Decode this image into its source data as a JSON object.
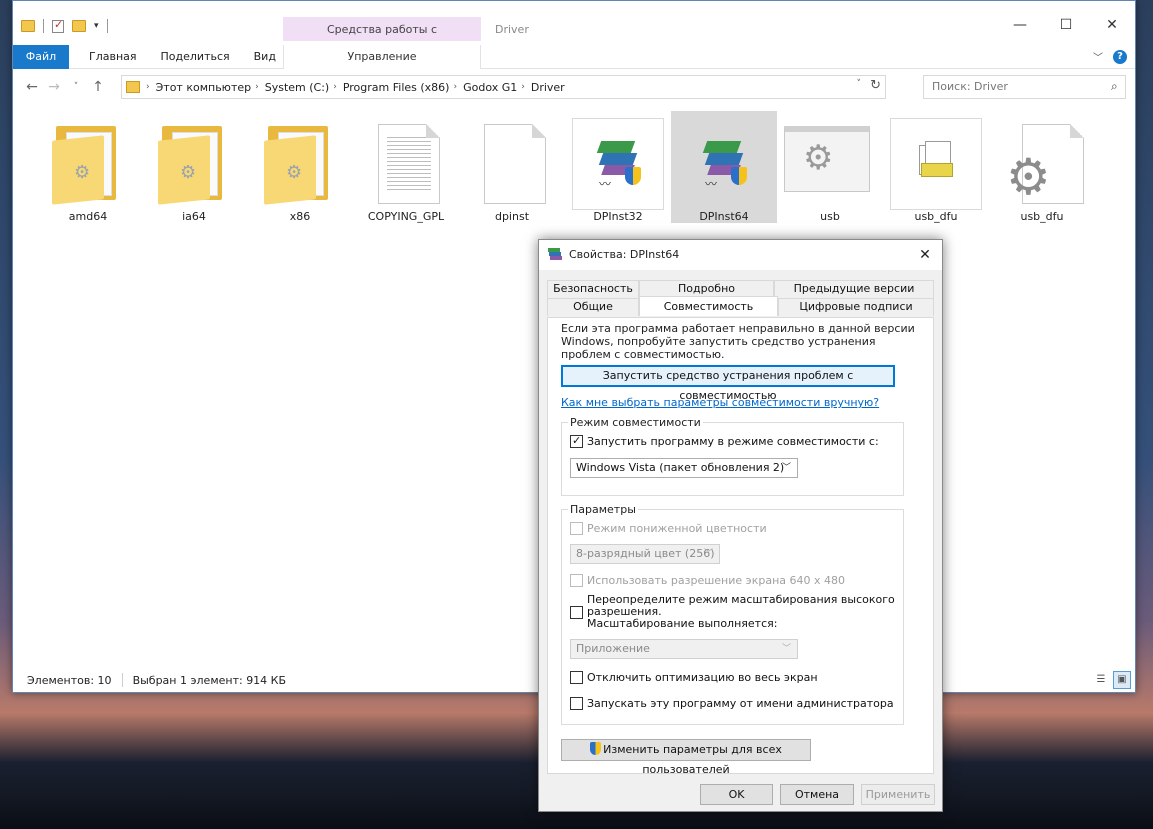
{
  "explorer": {
    "window_title": "Driver",
    "contextual_tab_title": "Средства работы с приложениями",
    "ribbon_tabs": [
      "Файл",
      "Главная",
      "Поделиться",
      "Вид"
    ],
    "contextual_tab": "Управление",
    "breadcrumb": [
      "Этот компьютер",
      "System (C:)",
      "Program Files (x86)",
      "Godox G1",
      "Driver"
    ],
    "search_placeholder": "Поиск: Driver",
    "files": [
      {
        "name": "amd64",
        "icon": "folder-icon"
      },
      {
        "name": "ia64",
        "icon": "folder-icon"
      },
      {
        "name": "x86",
        "icon": "folder-icon"
      },
      {
        "name": "COPYING_GPL",
        "icon": "text-document-icon"
      },
      {
        "name": "dpinst",
        "icon": "blank-document-icon"
      },
      {
        "name": "DPInst32",
        "icon": "installer-icon"
      },
      {
        "name": "DPInst64",
        "icon": "installer-icon",
        "selected": true
      },
      {
        "name": "usb",
        "icon": "settings-window-icon"
      },
      {
        "name": "usb_dfu",
        "icon": "setup-information-icon"
      },
      {
        "name": "usb_dfu",
        "icon": "gear-document-icon"
      }
    ],
    "status": {
      "items_count": "Элементов: 10",
      "selection": "Выбран 1 элемент: 914 КБ"
    }
  },
  "dialog": {
    "title": "Свойства: DPInst64",
    "tabs_row1": [
      "Безопасность",
      "Подробно",
      "Предыдущие версии"
    ],
    "tabs_row2": [
      "Общие",
      "Совместимость",
      "Цифровые подписи"
    ],
    "active_tab": "Совместимость",
    "description": "Если эта программа работает неправильно в данной версии Windows, попробуйте запустить средство устранения проблем с совместимостью.",
    "troubleshooter_button": "Запустить средство устранения проблем с совместимостью",
    "help_link": "Как мне выбрать параметры совместимости вручную?",
    "compat_mode": {
      "group_label": "Режим совместимости",
      "checkbox_label": "Запустить программу в режиме совместимости с:",
      "checked": true,
      "selected_os": "Windows Vista (пакет обновления 2)"
    },
    "params": {
      "group_label": "Параметры",
      "reduced_color_label": "Режим пониженной цветности",
      "color_select": "8-разрядный цвет (256)",
      "resolution_label": "Использовать разрешение экрана 640 x 480",
      "dpi_label_line1": "Переопределите режим масштабирования высокого",
      "dpi_label_line2": "разрешения.",
      "dpi_label_line3": "Масштабирование выполняется:",
      "dpi_select": "Приложение",
      "fullscreen_label": "Отключить оптимизацию во весь экран",
      "admin_label": "Запускать эту программу от имени администратора"
    },
    "all_users_button": "Изменить параметры для всех пользователей",
    "ok_button": "OK",
    "cancel_button": "Отмена",
    "apply_button": "Применить"
  }
}
